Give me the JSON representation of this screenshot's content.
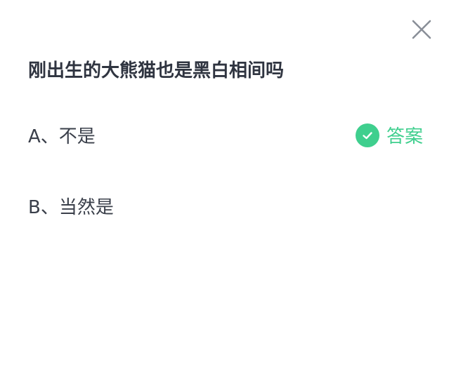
{
  "quiz": {
    "question": "刚出生的大熊猫也是黑白相间吗",
    "options": [
      {
        "label": "A、不是",
        "is_answer": true
      },
      {
        "label": "B、当然是",
        "is_answer": false
      }
    ],
    "answer_tag": {
      "label": "答案",
      "icon": "check-circle-icon"
    },
    "close_icon": "close-icon"
  },
  "colors": {
    "accent": "#3fcf8e",
    "text": "#333a45",
    "close": "#8a8f98"
  }
}
